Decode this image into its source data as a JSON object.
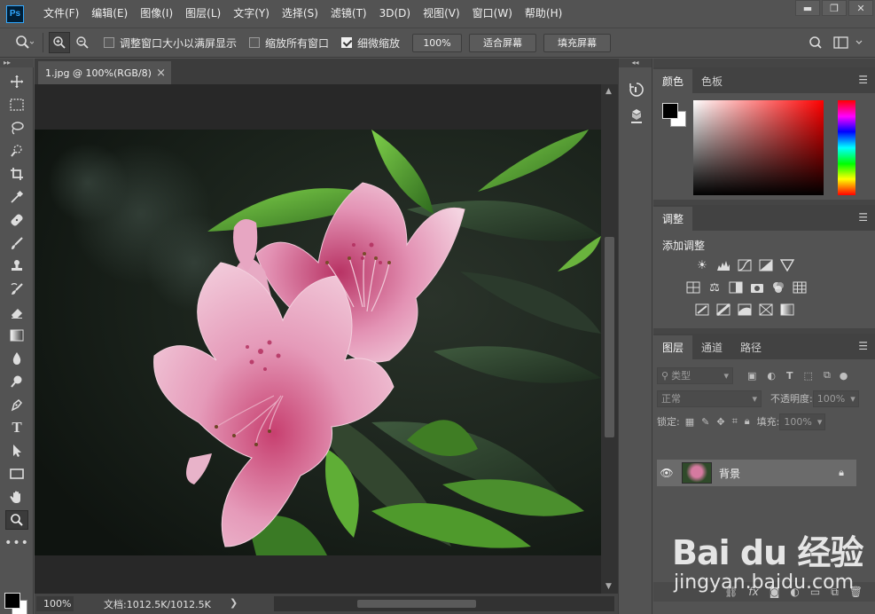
{
  "app": {
    "logo": "Ps"
  },
  "menu": {
    "items": [
      "文件(F)",
      "编辑(E)",
      "图像(I)",
      "图层(L)",
      "文字(Y)",
      "选择(S)",
      "滤镜(T)",
      "3D(D)",
      "视图(V)",
      "窗口(W)",
      "帮助(H)"
    ]
  },
  "window_controls": {
    "minimize": "▬",
    "restore": "❐",
    "close": "✕"
  },
  "options": {
    "resize_windows_label": "调整窗口大小以满屏显示",
    "resize_windows_checked": false,
    "zoom_all_label": "缩放所有窗口",
    "zoom_all_checked": false,
    "scrubby_zoom_label": "细微缩放",
    "scrubby_zoom_checked": true,
    "zoom_value": "100%",
    "fit_screen_label": "适合屏幕",
    "fill_screen_label": "填充屏幕"
  },
  "document": {
    "tab_title": "1.jpg @ 100%(RGB/8)",
    "tab_close": "×"
  },
  "status": {
    "zoom": "100%",
    "doc_info": "文档:1012.5K/1012.5K",
    "arrow": "❯"
  },
  "panels": {
    "color": {
      "tabs": [
        "颜色",
        "色板"
      ],
      "foreground": "#000000",
      "background": "#ffffff"
    },
    "adjustments": {
      "tab": "调整",
      "title": "添加调整"
    },
    "layers": {
      "tabs": [
        "图层",
        "通道",
        "路径"
      ],
      "filter_kind": "类型",
      "blend_mode": "正常",
      "opacity_label": "不透明度:",
      "opacity_value": "100%",
      "lock_label": "锁定:",
      "fill_label": "填充:",
      "fill_value": "100%",
      "layer_name": "背景"
    }
  },
  "watermark": {
    "brand": "Bai du 经验",
    "url": "jingyan.baidu.com"
  },
  "colors": {
    "accent": "#31a8ff",
    "ui_bg": "#535353",
    "dark_bg": "#282828"
  }
}
